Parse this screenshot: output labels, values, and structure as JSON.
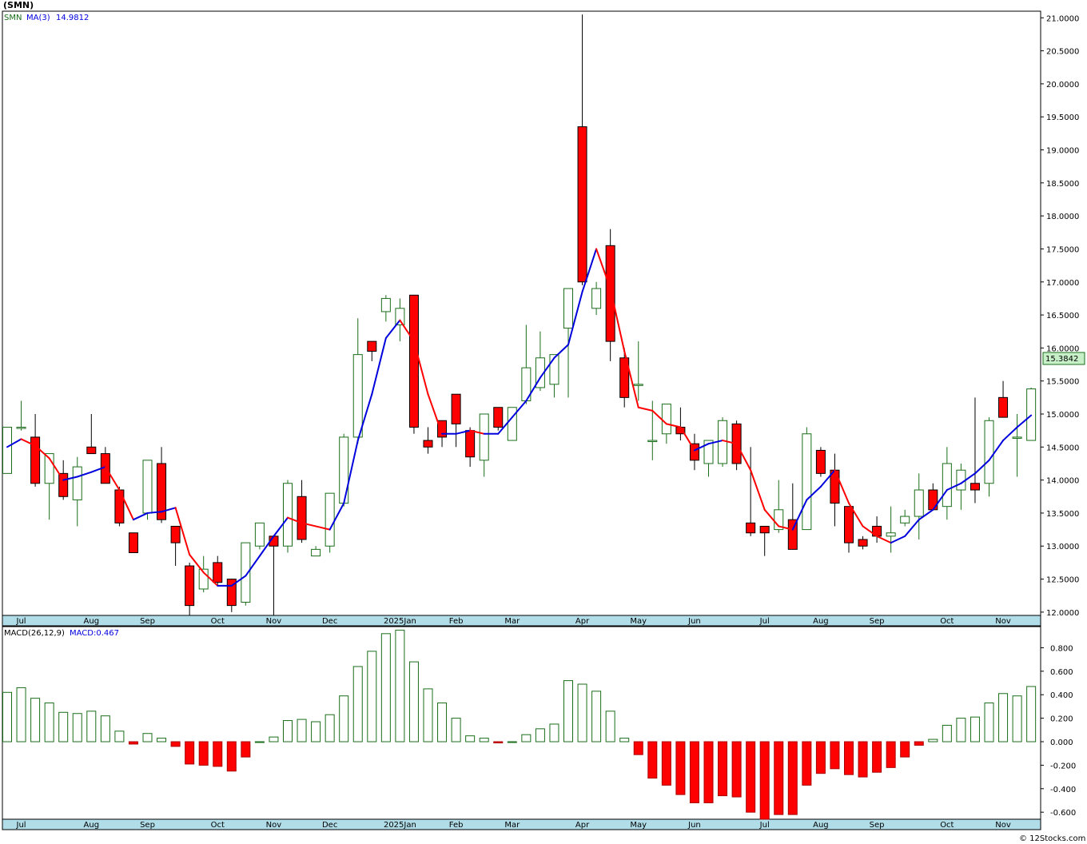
{
  "header": {
    "symbol_title": "(SMN)",
    "legend_symbol": "SMN",
    "legend_ma": "MA(3)",
    "legend_ma_value": "14.9812",
    "macd_legend": "MACD(26,12,9)",
    "macd_value_label": "MACD:0.467",
    "last_price": "15.3842",
    "footer": "© 12Stocks.com"
  },
  "colors": {
    "up": "#1a6e1a",
    "down_fill": "#ff0000",
    "ma_up": "#0000dd",
    "ma_down": "#ff0000",
    "axis_strip": "#b0dde8",
    "price_tag": "#c8f0c8",
    "grid": "#bbbbbb"
  },
  "chart_data": [
    {
      "type": "candlestick",
      "series_name": "SMN",
      "interval": "weekly",
      "y_ticks": [
        "12.0000",
        "12.5000",
        "13.0000",
        "13.5000",
        "14.0000",
        "14.5000",
        "15.0000",
        "15.5000",
        "16.0000",
        "16.5000",
        "17.0000",
        "17.5000",
        "18.0000",
        "18.5000",
        "19.0000",
        "19.5000",
        "20.0000",
        "20.5000",
        "21.0000"
      ],
      "ylim": [
        11.95,
        21.1
      ],
      "month_labels": [
        {
          "week": 1,
          "label": "Jul"
        },
        {
          "week": 6,
          "label": "Aug"
        },
        {
          "week": 10,
          "label": "Sep"
        },
        {
          "week": 15,
          "label": "Oct"
        },
        {
          "week": 19,
          "label": "Nov"
        },
        {
          "week": 23,
          "label": "Dec"
        },
        {
          "week": 28,
          "label": "2025Jan"
        },
        {
          "week": 32,
          "label": "Feb"
        },
        {
          "week": 36,
          "label": "Mar"
        },
        {
          "week": 41,
          "label": "Apr"
        },
        {
          "week": 45,
          "label": "May"
        },
        {
          "week": 49,
          "label": "Jun"
        },
        {
          "week": 54,
          "label": "Jul"
        },
        {
          "week": 58,
          "label": "Aug"
        },
        {
          "week": 62,
          "label": "Sep"
        },
        {
          "week": 67,
          "label": "Oct"
        },
        {
          "week": 71,
          "label": "Nov"
        }
      ],
      "ohlc": [
        [
          14.1,
          14.8,
          14.1,
          14.8
        ],
        [
          14.8,
          15.2,
          14.75,
          14.8
        ],
        [
          14.65,
          15.0,
          13.9,
          13.95
        ],
        [
          13.95,
          14.25,
          13.4,
          14.4
        ],
        [
          14.1,
          14.3,
          13.7,
          13.75
        ],
        [
          13.7,
          14.35,
          13.3,
          14.2
        ],
        [
          14.5,
          15.0,
          14.4,
          14.4
        ],
        [
          14.4,
          14.5,
          13.95,
          13.95
        ],
        [
          13.85,
          13.9,
          13.3,
          13.35
        ],
        [
          13.2,
          13.2,
          12.9,
          12.9
        ],
        [
          13.5,
          14.3,
          13.4,
          14.3
        ],
        [
          14.25,
          14.5,
          13.35,
          13.4
        ],
        [
          13.3,
          13.3,
          12.7,
          13.05
        ],
        [
          12.7,
          12.75,
          11.95,
          12.1
        ],
        [
          12.35,
          12.85,
          12.3,
          12.65
        ],
        [
          12.75,
          12.85,
          12.4,
          12.45
        ],
        [
          12.5,
          12.5,
          12.0,
          12.1
        ],
        [
          12.15,
          13.05,
          12.1,
          13.05
        ],
        [
          13.0,
          13.35,
          12.95,
          13.35
        ],
        [
          13.15,
          13.15,
          11.95,
          13.0
        ],
        [
          13.0,
          14.0,
          12.9,
          13.95
        ],
        [
          13.75,
          14.0,
          13.05,
          13.1
        ],
        [
          12.85,
          13.0,
          12.9,
          12.95
        ],
        [
          13.0,
          13.8,
          12.9,
          13.8
        ],
        [
          13.65,
          14.7,
          13.6,
          14.65
        ],
        [
          14.65,
          16.45,
          14.55,
          15.9
        ],
        [
          16.1,
          16.1,
          15.8,
          15.95
        ],
        [
          16.55,
          16.8,
          16.4,
          16.75
        ],
        [
          16.35,
          16.75,
          16.1,
          16.6
        ],
        [
          16.8,
          16.8,
          14.7,
          14.8
        ],
        [
          14.6,
          14.8,
          14.4,
          14.5
        ],
        [
          14.9,
          14.9,
          14.5,
          14.65
        ],
        [
          15.3,
          15.3,
          14.5,
          14.85
        ],
        [
          14.75,
          14.8,
          14.2,
          14.35
        ],
        [
          14.3,
          15.0,
          14.05,
          15.0
        ],
        [
          15.1,
          15.1,
          14.75,
          14.8
        ],
        [
          14.6,
          15.1,
          14.6,
          15.1
        ],
        [
          15.2,
          16.35,
          15.15,
          15.7
        ],
        [
          15.4,
          16.25,
          15.35,
          15.85
        ],
        [
          15.45,
          15.6,
          15.25,
          15.9
        ],
        [
          16.3,
          16.9,
          15.25,
          16.9
        ],
        [
          19.35,
          21.05,
          16.95,
          17.0
        ],
        [
          16.6,
          17.0,
          16.5,
          16.9
        ],
        [
          17.55,
          17.8,
          15.8,
          16.1
        ],
        [
          15.85,
          16.0,
          15.1,
          15.25
        ],
        [
          15.45,
          16.1,
          15.2,
          15.45
        ],
        [
          14.6,
          15.2,
          14.3,
          14.6
        ],
        [
          14.7,
          15.1,
          14.55,
          15.15
        ],
        [
          14.8,
          15.1,
          14.6,
          14.7
        ],
        [
          14.55,
          14.7,
          14.15,
          14.3
        ],
        [
          14.25,
          14.6,
          14.05,
          14.6
        ],
        [
          14.25,
          14.95,
          14.2,
          14.9
        ],
        [
          14.85,
          14.9,
          14.15,
          14.25
        ],
        [
          13.35,
          14.5,
          13.15,
          13.2
        ],
        [
          13.3,
          13.3,
          12.85,
          13.2
        ],
        [
          13.25,
          14.0,
          13.2,
          13.55
        ],
        [
          13.4,
          13.95,
          12.95,
          12.95
        ],
        [
          13.25,
          14.8,
          13.25,
          14.7
        ],
        [
          14.45,
          14.5,
          14.05,
          14.1
        ],
        [
          14.15,
          14.4,
          13.3,
          13.65
        ],
        [
          13.6,
          13.6,
          12.9,
          13.05
        ],
        [
          13.1,
          13.15,
          12.95,
          13.0
        ],
        [
          13.3,
          13.45,
          13.05,
          13.15
        ],
        [
          13.15,
          13.6,
          12.9,
          13.2
        ],
        [
          13.35,
          13.55,
          13.3,
          13.45
        ],
        [
          13.45,
          14.1,
          13.1,
          13.85
        ],
        [
          13.85,
          13.95,
          13.55,
          13.55
        ],
        [
          13.6,
          14.5,
          13.4,
          14.25
        ],
        [
          13.85,
          14.25,
          13.55,
          14.15
        ],
        [
          13.95,
          15.25,
          13.65,
          13.85
        ],
        [
          13.95,
          14.95,
          13.75,
          14.9
        ],
        [
          15.25,
          15.5,
          15.0,
          14.95
        ],
        [
          14.65,
          15.0,
          14.05,
          14.65
        ],
        [
          14.6,
          15.4,
          14.6,
          15.38
        ]
      ],
      "ma3": [
        14.5,
        14.62,
        14.52,
        14.33,
        14.0,
        14.05,
        14.12,
        14.2,
        13.85,
        13.4,
        13.5,
        13.52,
        13.58,
        12.87,
        12.6,
        12.4,
        12.4,
        12.55,
        12.85,
        13.15,
        13.43,
        13.35,
        13.3,
        13.25,
        13.65,
        14.6,
        15.3,
        16.15,
        16.42,
        16.1,
        15.3,
        14.7,
        14.7,
        14.75,
        14.7,
        14.7,
        14.95,
        15.2,
        15.55,
        15.85,
        16.05,
        16.85,
        17.5,
        16.9,
        15.95,
        15.1,
        15.05,
        14.85,
        14.8,
        14.45,
        14.55,
        14.6,
        14.55,
        14.15,
        13.55,
        13.3,
        13.25,
        13.7,
        13.9,
        14.15,
        13.65,
        13.3,
        13.15,
        13.05,
        13.15,
        13.4,
        13.55,
        13.85,
        13.95,
        14.1,
        14.3,
        14.6,
        14.8,
        14.98
      ],
      "last_price": 15.3842
    },
    {
      "type": "bar",
      "series_name": "MACD(26,12,9)",
      "y_ticks": [
        "-0.600",
        "-0.400",
        "-0.200",
        "0.000",
        "0.200",
        "0.400",
        "0.600",
        "0.800"
      ],
      "ylim": [
        -0.66,
        0.98
      ],
      "values": [
        0.42,
        0.46,
        0.37,
        0.33,
        0.25,
        0.24,
        0.26,
        0.22,
        0.09,
        -0.02,
        0.07,
        0.03,
        -0.04,
        -0.19,
        -0.2,
        -0.21,
        -0.25,
        -0.13,
        0.0,
        0.04,
        0.18,
        0.19,
        0.17,
        0.23,
        0.39,
        0.64,
        0.77,
        0.92,
        0.95,
        0.68,
        0.45,
        0.33,
        0.2,
        0.05,
        0.03,
        -0.01,
        0.0,
        0.06,
        0.11,
        0.15,
        0.52,
        0.49,
        0.43,
        0.26,
        0.03,
        -0.11,
        -0.31,
        -0.37,
        -0.45,
        -0.52,
        -0.52,
        -0.46,
        -0.47,
        -0.6,
        -0.66,
        -0.62,
        -0.62,
        -0.37,
        -0.27,
        -0.23,
        -0.28,
        -0.3,
        -0.26,
        -0.22,
        -0.13,
        -0.03,
        0.02,
        0.14,
        0.2,
        0.21,
        0.33,
        0.41,
        0.39,
        0.47
      ],
      "last_value": 0.467
    }
  ]
}
